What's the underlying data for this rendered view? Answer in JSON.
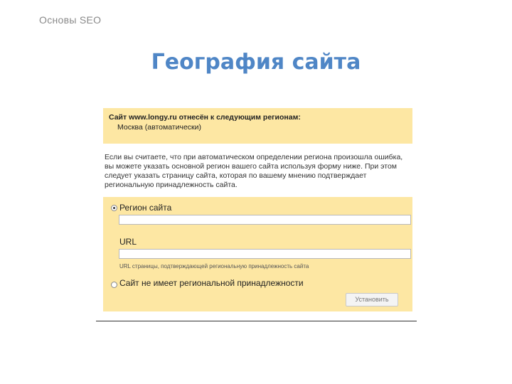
{
  "header": {
    "label": "Основы SEO"
  },
  "slide": {
    "title": "География сайта"
  },
  "notice": {
    "line1": "Сайт www.longy.ru отнесён к следующим регионам:",
    "line2": "Москва (автоматически)"
  },
  "description": {
    "text": "Если вы считаете, что при автоматическом определении региона произошла ошибка, вы можете указать основной регион вашего сайта используя форму ниже. При этом следует указать страницу сайта, которая по вашему мнению подтверждает региональную принадлежность сайта."
  },
  "form": {
    "region_option_label": "Регион сайта",
    "region_value": "",
    "url_label": "URL",
    "url_value": "",
    "url_hint": "URL страницы, подтверждающей региональную принадлежность сайта",
    "no_region_option_label": "Сайт не имеет региональной принадлежности",
    "submit_label": "Установить"
  }
}
